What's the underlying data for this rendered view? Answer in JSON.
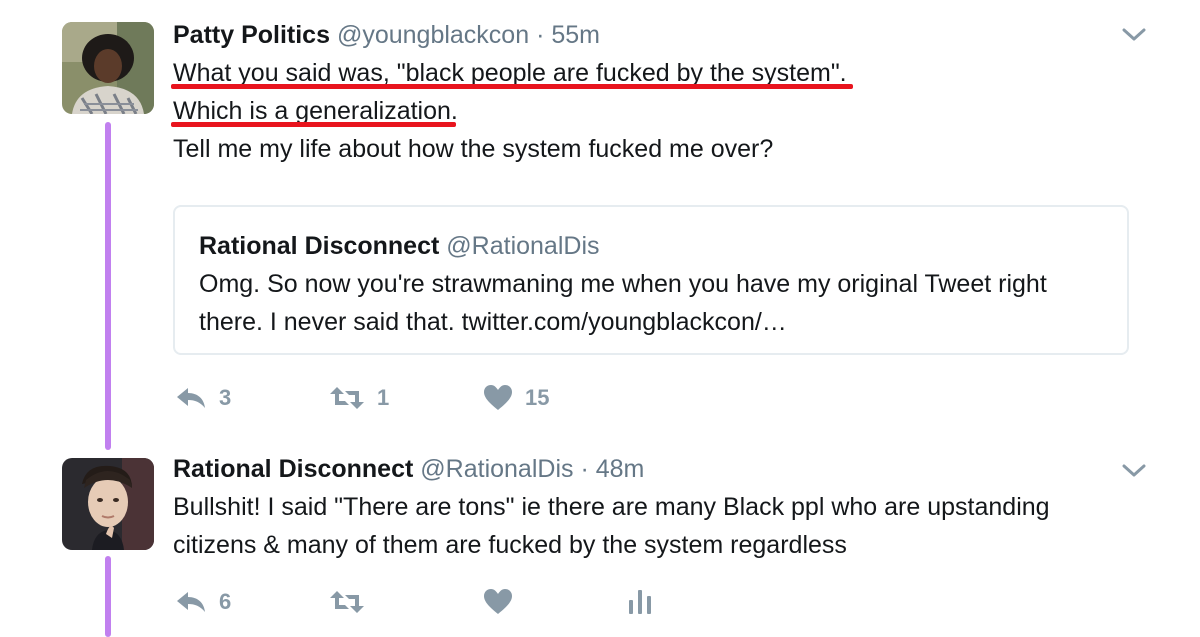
{
  "tweets": [
    {
      "name": "Patty Politics",
      "handle": "@youngblackcon",
      "separator": "·",
      "time": "55m",
      "lines": [
        "What you said was, \"black people are fucked by the system\".",
        "Which is a generalization.",
        "Tell me my life about how the system fucked me over?"
      ],
      "quote": {
        "name": "Rational Disconnect",
        "handle": "@RationalDis",
        "line1": "Omg. So now you're strawmaning me when you have my original Tweet right",
        "line2": "there. I never said that. twitter.com/youngblackcon/…"
      },
      "actions": {
        "reply_count": "3",
        "retweet_count": "1",
        "like_count": "15"
      }
    },
    {
      "name": "Rational Disconnect",
      "handle": "@RationalDis",
      "separator": "·",
      "time": "48m",
      "lines": [
        "Bullshit! I said \"There are tons\" ie there are many Black ppl who are upstanding",
        "citizens & many of them are fucked by the system regardless"
      ],
      "actions": {
        "reply_count": "6",
        "retweet_count": "",
        "like_count": ""
      }
    }
  ],
  "icons": {
    "reply": "reply-icon",
    "retweet": "retweet-icon",
    "like": "heart-icon",
    "analytics": "analytics-icon",
    "menu": "chevron-down-icon"
  },
  "colors": {
    "thread_line": "#c180ef",
    "underline_marker": "#e8141e",
    "meta_text": "#657786",
    "action_grey": "#8899a6",
    "card_border": "#e6ecf0"
  }
}
